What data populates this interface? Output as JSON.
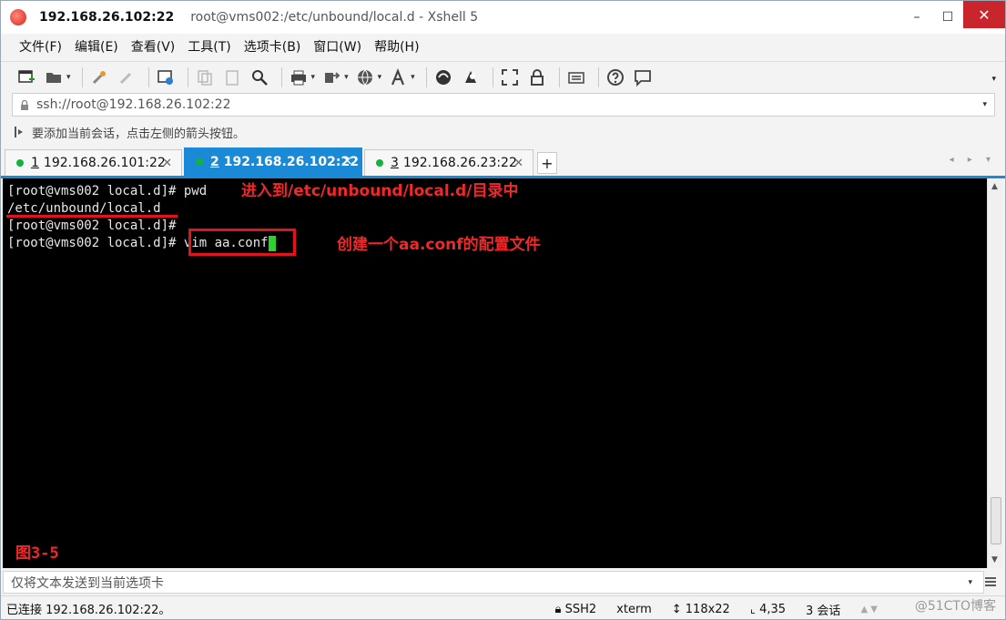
{
  "window": {
    "title_bold": "192.168.26.102:22",
    "title_path": "root@vms002:/etc/unbound/local.d - Xshell 5",
    "minimize": "–",
    "maximize": "☐",
    "close": "✕"
  },
  "menu": [
    "文件(F)",
    "编辑(E)",
    "查看(V)",
    "工具(T)",
    "选项卡(B)",
    "窗口(W)",
    "帮助(H)"
  ],
  "address": {
    "value": "ssh://root@192.168.26.102:22"
  },
  "hint": "要添加当前会话，点击左侧的箭头按钮。",
  "tabs": [
    {
      "num": "1",
      "label": "192.168.26.101:22",
      "active": false
    },
    {
      "num": "2",
      "label": "192.168.26.102:22",
      "active": true
    },
    {
      "num": "3",
      "label": "192.168.26.23:22",
      "active": false
    }
  ],
  "tab_add": "+",
  "tab_nav": "◂ ▸ ▾",
  "terminal": {
    "lines": [
      "[root@vms002 local.d]# pwd",
      "/etc/unbound/local.d",
      "[root@vms002 local.d]#",
      "[root@vms002 local.d]# vim aa.conf"
    ]
  },
  "annotations": {
    "note1": "进入到/etc/unbound/local.d/目录中",
    "note2": "创建一个aa.conf的配置文件",
    "figure": "图3-5",
    "color": "#f0282a"
  },
  "sendbar": {
    "placeholder": "仅将文本发送到当前选项卡"
  },
  "status": {
    "connected": "已连接 192.168.26.102:22。",
    "protocol": "SSH2",
    "term": "xterm",
    "size": "118x22",
    "position": "4,35",
    "sessions": "3 会话"
  },
  "watermark": "@51CTO博客",
  "colors": {
    "accent": "#1b8ad6",
    "tab_dot": "#12b33c",
    "cursor": "#2ed02e",
    "close": "#c8262c"
  }
}
